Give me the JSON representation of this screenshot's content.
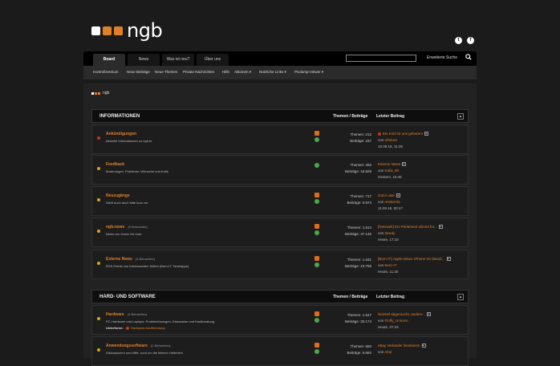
{
  "brand": {
    "logo_text": "ngb",
    "squares": [
      "#ffffff",
      "#e0812a",
      "#e0812a"
    ]
  },
  "social": [
    {
      "icon": "twitter-icon",
      "glyph": "t"
    },
    {
      "icon": "facebook-icon",
      "glyph": "f"
    }
  ],
  "tabs": [
    {
      "label": "Board",
      "active": true
    },
    {
      "label": "News",
      "active": false
    },
    {
      "label": "Was ist neu?",
      "active": false
    },
    {
      "label": "Über uns",
      "active": false
    }
  ],
  "search": {
    "placeholder": "",
    "advanced_label": "Erweiterte Suche"
  },
  "subnav": [
    "Kontrollzentrum",
    "Neue Beiträge",
    "Neue Themen",
    "Private Nachrichten",
    "Hilfe",
    "Aktionen ▾",
    "Nützliche Links ▾",
    "Picdump-Viewer ▾"
  ],
  "breadcrumb": {
    "label": "ngb"
  },
  "categories": [
    {
      "title": "INFORMATIONEN",
      "col_threads": "Themen / Beiträge",
      "col_last": "Letzter Beitrag"
    },
    {
      "title": "HARD- UND SOFTWARE",
      "col_threads": "Themen / Beiträge",
      "col_last": "Letzter Beitrag"
    }
  ],
  "forums": [
    {
      "name": "Ankündigungen",
      "viewers": "",
      "desc": "Aktuelle Informationen zu ngb.to",
      "subforums_label": "",
      "subforums": "",
      "threads": "Themen: 212",
      "posts": "Beiträge: 237",
      "last_title": "Ein Kind ist uns geboren!",
      "last_by_prefix": "von ",
      "last_by": "drfuture",
      "last_date": "10.09.18, 11:35",
      "dot": "#c03a1a",
      "rss": true,
      "new_badge": true
    },
    {
      "name": "Feedback",
      "viewers": "",
      "desc": "Änderungen, Probleme, Wünsche und Kritik",
      "subforums_label": "",
      "subforums": "",
      "threads": "Themen: 492",
      "posts": "Beiträge: 18.829",
      "last_title": "Externe News",
      "last_by_prefix": "von ",
      "last_by": "Kalia_90",
      "last_date": "Gestern, 15:45",
      "dot": "#d9a21a",
      "rss": false,
      "new_badge": false
    },
    {
      "name": "Neuzugänge",
      "viewers": "",
      "desc": "Stellt euch doch bitte kurz vor",
      "subforums_label": "",
      "subforums": "",
      "threads": "Themen: 717",
      "posts": "Beiträge: 9.974",
      "last_title": "GIGA user",
      "last_by_prefix": "von ",
      "last_by": "Amster33",
      "last_date": "11.09.18, 00:47",
      "dot": "#d9a21a",
      "rss": true,
      "new_badge": false
    },
    {
      "name": "ngb:news",
      "viewers": "(5 Betrachter)",
      "desc": "News von Usern für User",
      "subforums_label": "",
      "subforums": "",
      "threads": "Themen: 1.614",
      "posts": "Beiträge: 47.145",
      "last_title": "[Netzwelt] EU-Parlament stimmt für...",
      "last_by_prefix": "von ",
      "last_by": "Seedy",
      "last_date": "Heute, 17:10",
      "dot": "#d9a21a",
      "rss": true,
      "new_badge": false
    },
    {
      "name": "Externe News",
      "viewers": "(3 Betrachter)",
      "desc": "RSS-Feeds von interessanten Seiten (Born-IT, Tarnkappe)",
      "subforums_label": "",
      "subforums": "",
      "threads": "Themen: 1.631",
      "posts": "Beiträge: 10.756",
      "last_title": "[Born-IT] Apple-News: iPhone Xs (Max)/...",
      "last_by_prefix": "von ",
      "last_by": "Born-IT",
      "last_date": "Heute, 11:30",
      "dot": "#d9a21a",
      "rss": true,
      "new_badge": false
    },
    {
      "name": "Hardware",
      "viewers": "(3 Betrachter)",
      "desc": "PC-Hardware und Laptops: Problemlösungen, Diskussion und Kaufberatung",
      "subforums_label": "Unterforen:",
      "subforums": "Hardware-Kaufberatung",
      "threads": "Themen: 1.547",
      "posts": "Beiträge: 30.174",
      "last_title": "Netzteil abgeraucht, andere...",
      "last_by_prefix": "von ",
      "last_by": "Fluffy_Unicorn",
      "last_date": "Heute, 07:24",
      "dot": "#d9a21a",
      "rss": true,
      "new_badge": false
    },
    {
      "name": "Anwendungssoftware",
      "viewers": "(2 Betrachter)",
      "desc": "Diskussionen und Hilfe, rund um die kleinen Helferlein",
      "subforums_label": "",
      "subforums": "",
      "threads": "Themen: 660",
      "posts": "Beiträge: 6.692",
      "last_title": "eBay Verkäufer blockieren",
      "last_by_prefix": "von ",
      "last_by": "Abul",
      "last_date": "",
      "dot": "#d9a21a",
      "rss": true,
      "new_badge": false
    }
  ]
}
